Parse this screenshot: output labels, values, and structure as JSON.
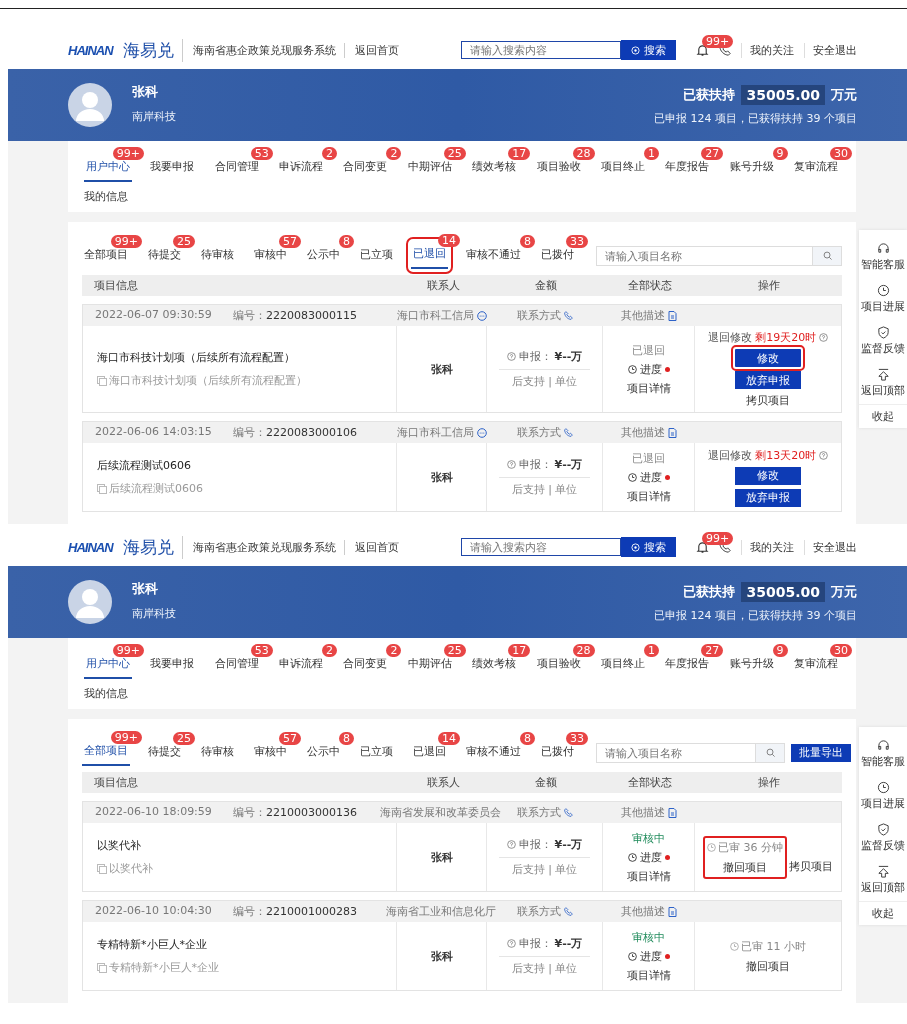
{
  "panels": [
    {
      "header": {
        "logo": "HAINAN",
        "brand": "海易兑",
        "system": "海南省惠企政策兑现服务系统",
        "home": "返回首页",
        "search_placeholder": "请输入搜索内容",
        "search_button": "搜索",
        "bell_badge": "99+",
        "links": [
          "我的关注",
          "安全退出"
        ]
      },
      "banner": {
        "name": "张科",
        "company": "南岸科技",
        "support_label": "已获扶持",
        "support_amount": "35005.00",
        "support_unit": "万元",
        "summary": "已申报 124 项目，已获得扶持 39 个项目"
      },
      "nav": [
        {
          "label": "用户中心",
          "badge": "99+",
          "selected": true
        },
        {
          "label": "我要申报",
          "selected": false
        },
        {
          "label": "合同管理",
          "badge": "53",
          "selected": false
        },
        {
          "label": "申诉流程",
          "badge": "2",
          "selected": false
        },
        {
          "label": "合同变更",
          "badge": "2",
          "selected": false
        },
        {
          "label": "中期评估",
          "badge": "25",
          "selected": false
        },
        {
          "label": "绩效考核",
          "badge": "17",
          "selected": false
        },
        {
          "label": "项目验收",
          "badge": "28",
          "selected": false
        },
        {
          "label": "项目终止",
          "badge": "1",
          "selected": false
        },
        {
          "label": "年度报告",
          "badge": "27",
          "selected": false
        },
        {
          "label": "账号升级",
          "badge": "9",
          "selected": false
        },
        {
          "label": "复审流程",
          "badge": "30",
          "selected": false
        }
      ],
      "subnav": [
        "我的信息"
      ],
      "filters": [
        {
          "label": "全部项目",
          "badge": "99+",
          "selected": false
        },
        {
          "label": "待提交",
          "badge": "25",
          "selected": false
        },
        {
          "label": "待审核",
          "selected": false
        },
        {
          "label": "审核中",
          "badge": "57",
          "selected": false
        },
        {
          "label": "公示中",
          "badge": "8",
          "selected": false
        },
        {
          "label": "已立项",
          "selected": false
        },
        {
          "label": "已退回",
          "badge": "14",
          "selected": true,
          "highlighted": true
        },
        {
          "label": "审核不通过",
          "badge": "8",
          "selected": false
        },
        {
          "label": "已拨付",
          "badge": "33",
          "selected": false
        }
      ],
      "project_search_placeholder": "请输入项目名称",
      "columns": [
        "项目信息",
        "联系人",
        "金额",
        "全部状态",
        "操作"
      ],
      "rows": [
        {
          "date": "2022-06-07 09:30:59",
          "number_label": "编号：",
          "number": "2220083000115",
          "department": "海口市科工信局",
          "contact_label": "联系方式",
          "other_label": "其他描述",
          "subtitle": "海口市科技计划项（后续所有流程配置）",
          "title_full": "海口市科技计划项（后续所有流程配置）",
          "person": "张科",
          "amount_label": "申报：",
          "amount": "¥--万",
          "amount_note": "后支持 | 单位",
          "status": {
            "text": "已退回",
            "kind": "returned"
          },
          "progress": "进度",
          "detail": "项目详情",
          "op": {
            "kind": "returned",
            "label": "退回修改",
            "remain": "剩19天20时",
            "buttons": [
              {
                "label": "修改",
                "highlighted": true
              },
              {
                "label": "放弃申报",
                "highlighted": false
              }
            ],
            "link": "拷贝项目"
          }
        },
        {
          "date": "2022-06-06 14:03:15",
          "number_label": "编号：",
          "number": "2220083000106",
          "department": "海口市科工信局",
          "contact_label": "联系方式",
          "other_label": "其他描述",
          "title_full": "后续流程测试0606",
          "subtitle": "后续流程测试0606",
          "person": "张科",
          "amount_label": "申报：",
          "amount": "¥--万",
          "amount_note": "后支持 | 单位",
          "status": {
            "text": "已退回",
            "kind": "returned"
          },
          "progress": "进度",
          "detail": "项目详情",
          "op": {
            "kind": "returned",
            "label": "退回修改",
            "remain": "剩13天20时",
            "buttons": [
              {
                "label": "修改",
                "highlighted": false
              },
              {
                "label": "放弃申报",
                "highlighted": false
              }
            ]
          }
        }
      ],
      "sidebar": [
        {
          "label": "智能客服",
          "kind": "headset"
        },
        {
          "label": "项目进展",
          "kind": "clock"
        },
        {
          "label": "监督反馈",
          "kind": "shield"
        },
        {
          "label": "返回顶部",
          "kind": "top"
        }
      ],
      "collapse": "收起"
    },
    {
      "header": {
        "logo": "HAINAN",
        "brand": "海易兑",
        "system": "海南省惠企政策兑现服务系统",
        "home": "返回首页",
        "search_placeholder": "请输入搜索内容",
        "search_button": "搜索",
        "bell_badge": "99+",
        "links": [
          "我的关注",
          "安全退出"
        ]
      },
      "banner": {
        "name": "张科",
        "company": "南岸科技",
        "support_label": "已获扶持",
        "support_amount": "35005.00",
        "support_unit": "万元",
        "summary": "已申报 124 项目，已获得扶持 39 个项目"
      },
      "nav": [
        {
          "label": "用户中心",
          "badge": "99+",
          "selected": true
        },
        {
          "label": "我要申报",
          "selected": false
        },
        {
          "label": "合同管理",
          "badge": "53",
          "selected": false
        },
        {
          "label": "申诉流程",
          "badge": "2",
          "selected": false
        },
        {
          "label": "合同变更",
          "badge": "2",
          "selected": false
        },
        {
          "label": "中期评估",
          "badge": "25",
          "selected": false
        },
        {
          "label": "绩效考核",
          "badge": "17",
          "selected": false
        },
        {
          "label": "项目验收",
          "badge": "28",
          "selected": false
        },
        {
          "label": "项目终止",
          "badge": "1",
          "selected": false
        },
        {
          "label": "年度报告",
          "badge": "27",
          "selected": false
        },
        {
          "label": "账号升级",
          "badge": "9",
          "selected": false
        },
        {
          "label": "复审流程",
          "badge": "30",
          "selected": false
        }
      ],
      "subnav": [
        "我的信息"
      ],
      "filters": [
        {
          "label": "全部项目",
          "badge": "99+",
          "selected": true
        },
        {
          "label": "待提交",
          "badge": "25",
          "selected": false
        },
        {
          "label": "待审核",
          "selected": false
        },
        {
          "label": "审核中",
          "badge": "57",
          "selected": false
        },
        {
          "label": "公示中",
          "badge": "8",
          "selected": false
        },
        {
          "label": "已立项",
          "selected": false
        },
        {
          "label": "已退回",
          "badge": "14",
          "selected": false
        },
        {
          "label": "审核不通过",
          "badge": "8",
          "selected": false
        },
        {
          "label": "已拨付",
          "badge": "33",
          "selected": false
        }
      ],
      "project_search_placeholder": "请输入项目名称",
      "export_button": "批量导出",
      "columns": [
        "项目信息",
        "联系人",
        "金额",
        "全部状态",
        "操作"
      ],
      "rows": [
        {
          "date": "2022-06-10 18:09:59",
          "number_label": "编号：",
          "number": "2210003000136",
          "department": "海南省发展和改革委员会",
          "contact_label": "联系方式",
          "other_label": "其他描述",
          "title_full": "以奖代补",
          "subtitle": "以奖代补",
          "person": "张科",
          "amount_label": "申报：",
          "amount": "¥--万",
          "amount_note": "后支持 | 单位",
          "status": {
            "text": "审核中",
            "kind": "reviewing"
          },
          "progress": "进度",
          "detail": "项目详情",
          "op": {
            "kind": "review",
            "timer": "已审 36 分钟",
            "links": [
              "撤回项目",
              "拷贝项目"
            ],
            "highlighted": true
          }
        },
        {
          "date": "2022-06-10 10:04:30",
          "number_label": "编号：",
          "number": "2210001000283",
          "department": "海南省工业和信息化厅",
          "contact_label": "联系方式",
          "other_label": "其他描述",
          "title_full": "专精特新*小巨人*企业",
          "subtitle": "专精特新*小巨人*企业",
          "person": "张科",
          "amount_label": "申报：",
          "amount": "¥--万",
          "amount_note": "后支持 | 单位",
          "status": {
            "text": "审核中",
            "kind": "reviewing"
          },
          "progress": "进度",
          "detail": "项目详情",
          "op": {
            "kind": "review",
            "timer": "已审 11 小时",
            "links": [
              "撤回项目"
            ],
            "highlighted": false
          }
        }
      ],
      "sidebar": [
        {
          "label": "智能客服",
          "kind": "headset"
        },
        {
          "label": "项目进展",
          "kind": "clock"
        },
        {
          "label": "监督反馈",
          "kind": "shield"
        },
        {
          "label": "返回顶部",
          "kind": "top"
        }
      ],
      "collapse": "收起"
    }
  ]
}
